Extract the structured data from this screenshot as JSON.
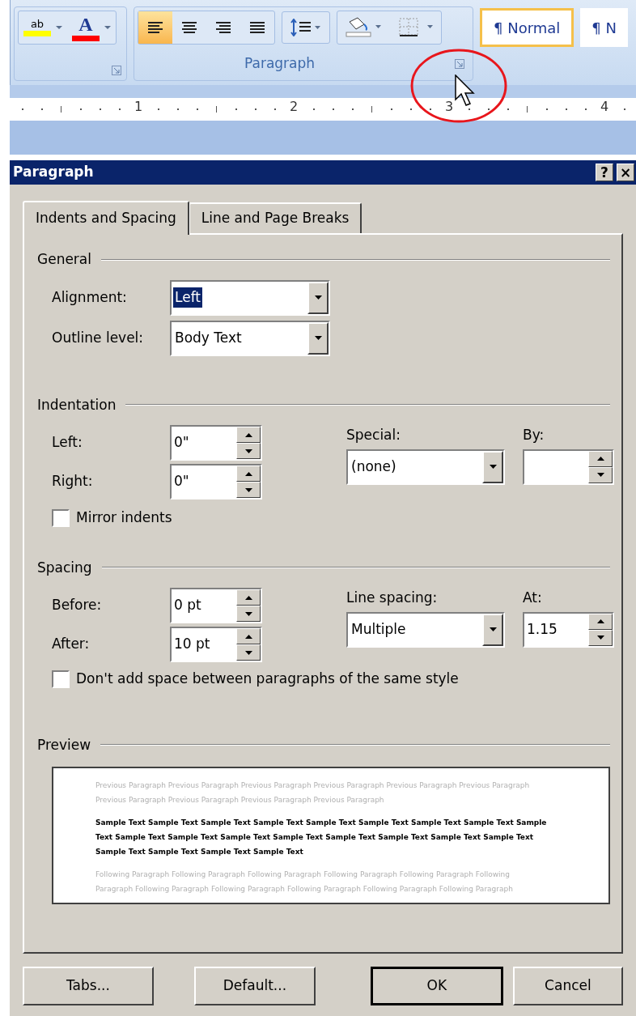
{
  "ribbon": {
    "font_buttons": [
      {
        "kind": "highlight",
        "glyph": "ab",
        "color": "#ffff00"
      },
      {
        "kind": "font_color",
        "glyph": "A",
        "color": "#ff0000"
      }
    ],
    "alignment_buttons": [
      {
        "kind": "left",
        "selected": true
      },
      {
        "kind": "center",
        "selected": false
      },
      {
        "kind": "right",
        "selected": false
      },
      {
        "kind": "justify",
        "selected": false
      }
    ],
    "group_label": "Paragraph",
    "styles": [
      {
        "label": "¶ Normal",
        "selected": true
      },
      {
        "label": "¶ N",
        "selected": false
      }
    ]
  },
  "ruler": {
    "numbers": [
      "1",
      "2",
      "3",
      "4"
    ]
  },
  "dialog": {
    "title": "Paragraph",
    "title_buttons": [
      "?",
      "×"
    ],
    "tabs": [
      {
        "label": "Indents and Spacing",
        "selected": true
      },
      {
        "label": "Line and Page Breaks",
        "selected": false
      }
    ],
    "general": {
      "heading": "General",
      "fields": [
        {
          "label": "Alignment:",
          "value": "Left",
          "highlighted": true
        },
        {
          "label": "Outline level:",
          "value": "Body Text",
          "highlighted": false
        }
      ]
    },
    "indentation": {
      "heading": "Indentation",
      "left": {
        "label": "Left:",
        "value": "0\""
      },
      "right": {
        "label": "Right:",
        "value": "0\""
      },
      "special": {
        "label": "Special:",
        "value": "(none)"
      },
      "by": {
        "label": "By:"
      },
      "mirror": {
        "label": "Mirror indents",
        "checked": false
      }
    },
    "spacing": {
      "heading": "Spacing",
      "before": {
        "label": "Before:",
        "value": "0 pt"
      },
      "after": {
        "label": "After:",
        "value": "10 pt"
      },
      "line_spacing": {
        "label": "Line spacing:",
        "value": "Multiple"
      },
      "at": {
        "label": "At:",
        "value": "1.15"
      },
      "dont_add": {
        "label": "Don't add space between paragraphs of the same style",
        "checked": false
      }
    },
    "preview": {
      "heading": "Preview",
      "previous": "Previous Paragraph Previous Paragraph Previous Paragraph Previous Paragraph Previous Paragraph Previous Paragraph Previous Paragraph Previous Paragraph Previous Paragraph Previous Paragraph",
      "sample": "Sample Text Sample Text Sample Text Sample Text Sample Text Sample Text Sample Text Sample Text Sample Text Sample Text Sample Text Sample Text Sample Text Sample Text Sample Text Sample Text Sample Text Sample Text Sample Text Sample Text Sample Text",
      "following": "Following Paragraph Following Paragraph Following Paragraph Following Paragraph Following Paragraph Following Paragraph Following Paragraph Following Paragraph Following Paragraph Following Paragraph Following Paragraph"
    },
    "buttons": [
      {
        "label": "Tabs...",
        "default": false
      },
      {
        "label": "Default...",
        "default": false
      },
      {
        "label": "OK",
        "default": true
      },
      {
        "label": "Cancel",
        "default": false
      }
    ]
  }
}
